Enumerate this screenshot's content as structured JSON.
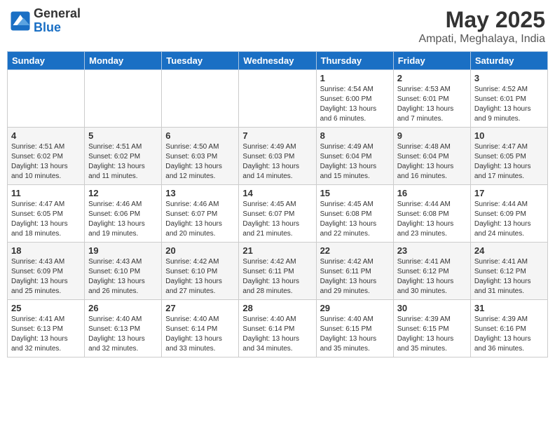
{
  "logo": {
    "general": "General",
    "blue": "Blue"
  },
  "title": "May 2025",
  "location": "Ampati, Meghalaya, India",
  "days_of_week": [
    "Sunday",
    "Monday",
    "Tuesday",
    "Wednesday",
    "Thursday",
    "Friday",
    "Saturday"
  ],
  "weeks": [
    [
      {
        "day": "",
        "info": ""
      },
      {
        "day": "",
        "info": ""
      },
      {
        "day": "",
        "info": ""
      },
      {
        "day": "",
        "info": ""
      },
      {
        "day": "1",
        "info": "Sunrise: 4:54 AM\nSunset: 6:00 PM\nDaylight: 13 hours and 6 minutes."
      },
      {
        "day": "2",
        "info": "Sunrise: 4:53 AM\nSunset: 6:01 PM\nDaylight: 13 hours and 7 minutes."
      },
      {
        "day": "3",
        "info": "Sunrise: 4:52 AM\nSunset: 6:01 PM\nDaylight: 13 hours and 9 minutes."
      }
    ],
    [
      {
        "day": "4",
        "info": "Sunrise: 4:51 AM\nSunset: 6:02 PM\nDaylight: 13 hours and 10 minutes."
      },
      {
        "day": "5",
        "info": "Sunrise: 4:51 AM\nSunset: 6:02 PM\nDaylight: 13 hours and 11 minutes."
      },
      {
        "day": "6",
        "info": "Sunrise: 4:50 AM\nSunset: 6:03 PM\nDaylight: 13 hours and 12 minutes."
      },
      {
        "day": "7",
        "info": "Sunrise: 4:49 AM\nSunset: 6:03 PM\nDaylight: 13 hours and 14 minutes."
      },
      {
        "day": "8",
        "info": "Sunrise: 4:49 AM\nSunset: 6:04 PM\nDaylight: 13 hours and 15 minutes."
      },
      {
        "day": "9",
        "info": "Sunrise: 4:48 AM\nSunset: 6:04 PM\nDaylight: 13 hours and 16 minutes."
      },
      {
        "day": "10",
        "info": "Sunrise: 4:47 AM\nSunset: 6:05 PM\nDaylight: 13 hours and 17 minutes."
      }
    ],
    [
      {
        "day": "11",
        "info": "Sunrise: 4:47 AM\nSunset: 6:05 PM\nDaylight: 13 hours and 18 minutes."
      },
      {
        "day": "12",
        "info": "Sunrise: 4:46 AM\nSunset: 6:06 PM\nDaylight: 13 hours and 19 minutes."
      },
      {
        "day": "13",
        "info": "Sunrise: 4:46 AM\nSunset: 6:07 PM\nDaylight: 13 hours and 20 minutes."
      },
      {
        "day": "14",
        "info": "Sunrise: 4:45 AM\nSunset: 6:07 PM\nDaylight: 13 hours and 21 minutes."
      },
      {
        "day": "15",
        "info": "Sunrise: 4:45 AM\nSunset: 6:08 PM\nDaylight: 13 hours and 22 minutes."
      },
      {
        "day": "16",
        "info": "Sunrise: 4:44 AM\nSunset: 6:08 PM\nDaylight: 13 hours and 23 minutes."
      },
      {
        "day": "17",
        "info": "Sunrise: 4:44 AM\nSunset: 6:09 PM\nDaylight: 13 hours and 24 minutes."
      }
    ],
    [
      {
        "day": "18",
        "info": "Sunrise: 4:43 AM\nSunset: 6:09 PM\nDaylight: 13 hours and 25 minutes."
      },
      {
        "day": "19",
        "info": "Sunrise: 4:43 AM\nSunset: 6:10 PM\nDaylight: 13 hours and 26 minutes."
      },
      {
        "day": "20",
        "info": "Sunrise: 4:42 AM\nSunset: 6:10 PM\nDaylight: 13 hours and 27 minutes."
      },
      {
        "day": "21",
        "info": "Sunrise: 4:42 AM\nSunset: 6:11 PM\nDaylight: 13 hours and 28 minutes."
      },
      {
        "day": "22",
        "info": "Sunrise: 4:42 AM\nSunset: 6:11 PM\nDaylight: 13 hours and 29 minutes."
      },
      {
        "day": "23",
        "info": "Sunrise: 4:41 AM\nSunset: 6:12 PM\nDaylight: 13 hours and 30 minutes."
      },
      {
        "day": "24",
        "info": "Sunrise: 4:41 AM\nSunset: 6:12 PM\nDaylight: 13 hours and 31 minutes."
      }
    ],
    [
      {
        "day": "25",
        "info": "Sunrise: 4:41 AM\nSunset: 6:13 PM\nDaylight: 13 hours and 32 minutes."
      },
      {
        "day": "26",
        "info": "Sunrise: 4:40 AM\nSunset: 6:13 PM\nDaylight: 13 hours and 32 minutes."
      },
      {
        "day": "27",
        "info": "Sunrise: 4:40 AM\nSunset: 6:14 PM\nDaylight: 13 hours and 33 minutes."
      },
      {
        "day": "28",
        "info": "Sunrise: 4:40 AM\nSunset: 6:14 PM\nDaylight: 13 hours and 34 minutes."
      },
      {
        "day": "29",
        "info": "Sunrise: 4:40 AM\nSunset: 6:15 PM\nDaylight: 13 hours and 35 minutes."
      },
      {
        "day": "30",
        "info": "Sunrise: 4:39 AM\nSunset: 6:15 PM\nDaylight: 13 hours and 35 minutes."
      },
      {
        "day": "31",
        "info": "Sunrise: 4:39 AM\nSunset: 6:16 PM\nDaylight: 13 hours and 36 minutes."
      }
    ]
  ]
}
